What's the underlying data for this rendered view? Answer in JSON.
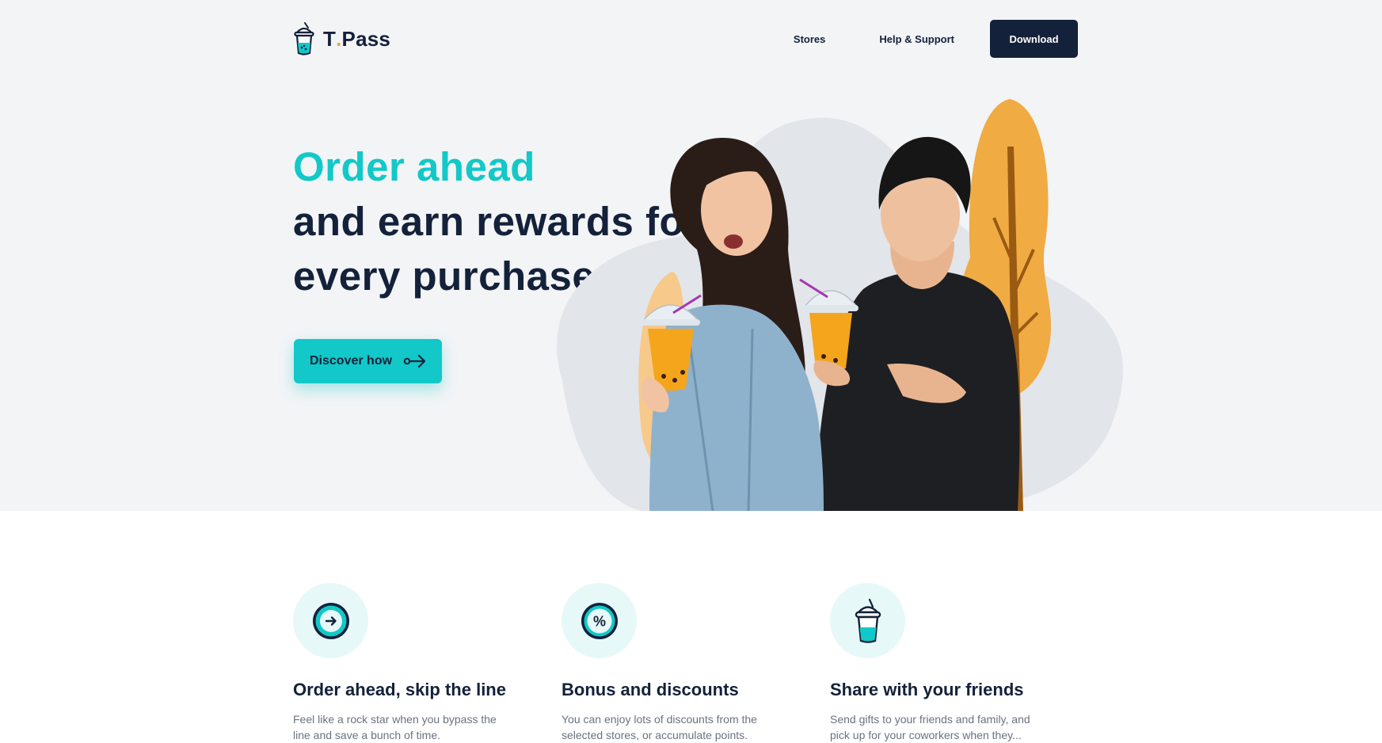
{
  "brand": {
    "name_main": "T",
    "name_dot": ".",
    "name_rest": "Pass"
  },
  "nav": {
    "stores": "Stores",
    "help": "Help & Support",
    "download": "Download"
  },
  "hero": {
    "headline_accent": "Order ahead",
    "headline_line2": "and earn rewards for",
    "headline_line3": "every purchase",
    "headline_period": ".",
    "cta": "Discover how"
  },
  "features": [
    {
      "icon": "arrow-circle-icon",
      "title": "Order ahead, skip the line",
      "text": "Feel like a rock star when you bypass the line and save a bunch of time."
    },
    {
      "icon": "percent-icon",
      "title": "Bonus and discounts",
      "text": "You can enjoy lots of discounts from the selected stores, or accumulate points."
    },
    {
      "icon": "bubble-tea-cup-icon",
      "title": "Share with your friends",
      "text": "Send gifts to your friends and family, and pick up for your coworkers when they..."
    }
  ],
  "colors": {
    "accent": "#12c8c8",
    "navy": "#14213a",
    "orange": "#f0a63c",
    "hero_bg": "#f2f4f6"
  }
}
